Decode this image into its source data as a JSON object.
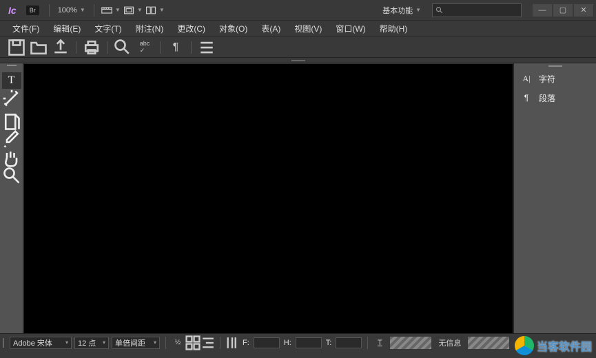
{
  "app": {
    "logo": "Ic",
    "bridge_badge": "Br",
    "zoom": "100%"
  },
  "workspace": {
    "label": "基本功能"
  },
  "search": {
    "placeholder": ""
  },
  "menu": {
    "file": "文件(F)",
    "edit": "编辑(E)",
    "text": "文字(T)",
    "notes": "附注(N)",
    "changes": "更改(C)",
    "object": "对象(O)",
    "table": "表(A)",
    "view": "视图(V)",
    "window": "窗口(W)",
    "help": "帮助(H)"
  },
  "right_panels": {
    "character": "字符",
    "paragraph": "段落"
  },
  "bottombar": {
    "font": "Adobe 宋体",
    "size": "12 点",
    "leading": "单倍间距",
    "f_label": "F:",
    "h_label": "H:",
    "t_label": "T:",
    "noinfo": "无信息"
  },
  "watermark": "当客软件园"
}
